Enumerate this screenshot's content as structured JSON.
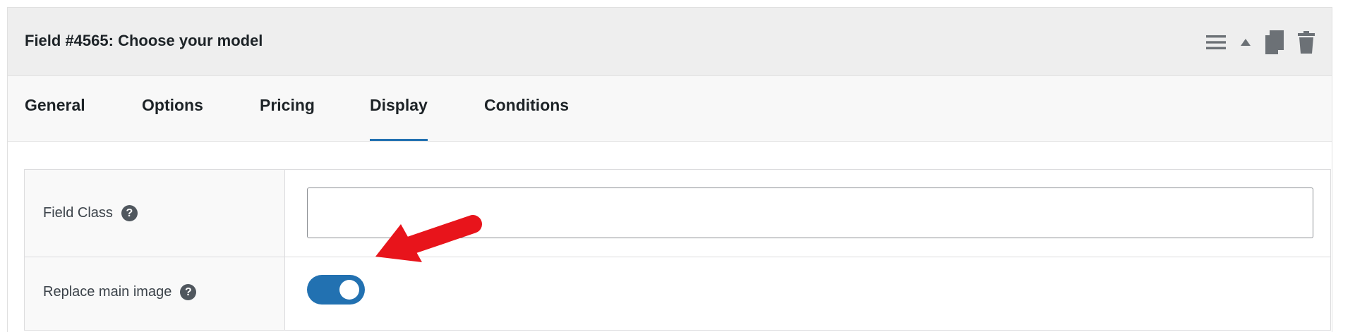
{
  "header": {
    "title": "Field #4565: Choose your model",
    "actions": [
      {
        "name": "menu-icon"
      },
      {
        "name": "collapse-icon"
      },
      {
        "name": "duplicate-icon"
      },
      {
        "name": "trash-icon"
      }
    ]
  },
  "tabs": [
    {
      "label": "General",
      "active": false
    },
    {
      "label": "Options",
      "active": false
    },
    {
      "label": "Pricing",
      "active": false
    },
    {
      "label": "Display",
      "active": true
    },
    {
      "label": "Conditions",
      "active": false
    }
  ],
  "settings": {
    "field_class": {
      "label": "Field Class",
      "help": "?",
      "value": "",
      "placeholder": ""
    },
    "replace_main_image": {
      "label": "Replace main image",
      "help": "?",
      "enabled": true
    }
  },
  "colors": {
    "accent": "#2271b1",
    "annotation_arrow": "#e8141b",
    "header_bg": "#eeeeee"
  }
}
